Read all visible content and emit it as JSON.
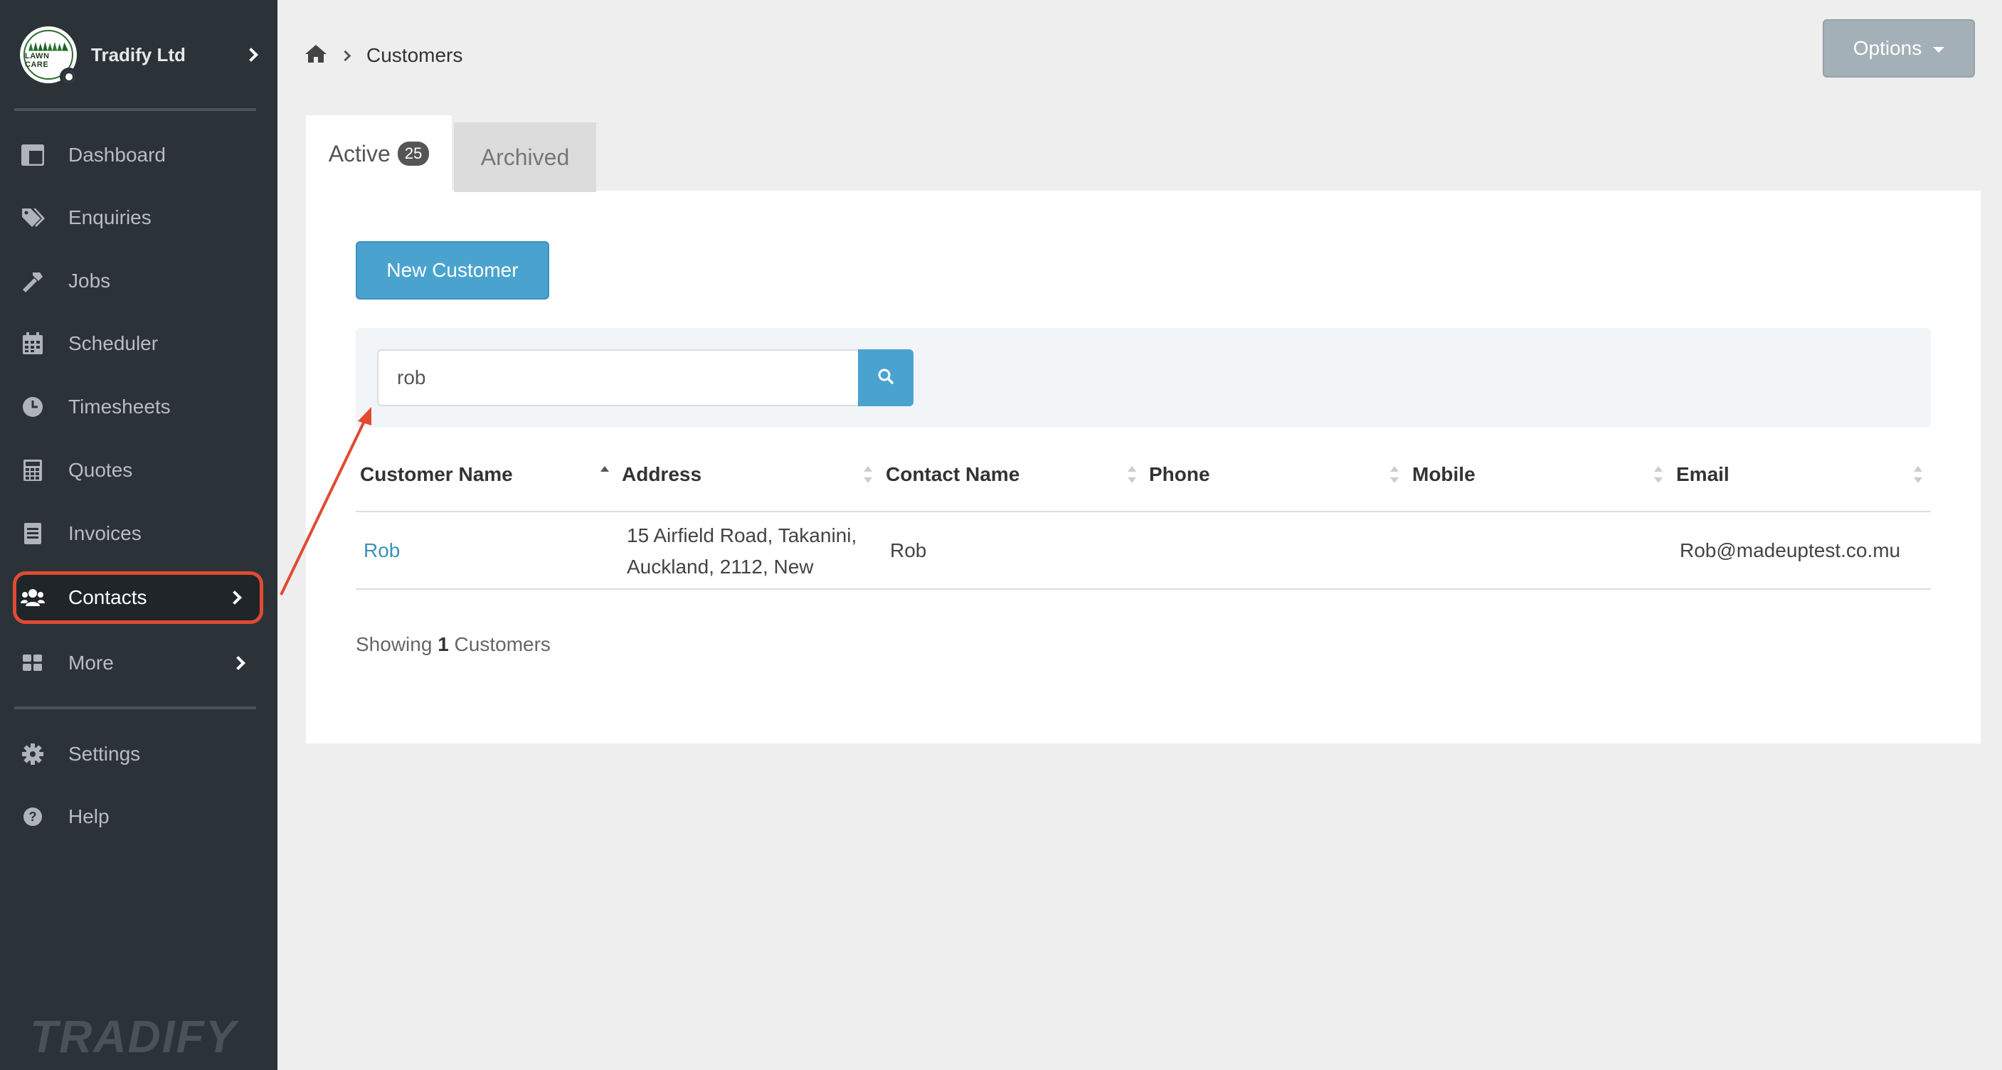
{
  "sidebar": {
    "org_name": "Tradify Ltd",
    "logo_text": "LAWN CARE",
    "items": [
      {
        "label": "Dashboard",
        "icon": "dashboard-icon"
      },
      {
        "label": "Enquiries",
        "icon": "tags-icon"
      },
      {
        "label": "Jobs",
        "icon": "hammer-icon"
      },
      {
        "label": "Scheduler",
        "icon": "calendar-icon"
      },
      {
        "label": "Timesheets",
        "icon": "clock-icon"
      },
      {
        "label": "Quotes",
        "icon": "calculator-icon"
      },
      {
        "label": "Invoices",
        "icon": "invoice-icon"
      },
      {
        "label": "Contacts",
        "icon": "users-icon",
        "active": true
      },
      {
        "label": "More",
        "icon": "grid-icon"
      }
    ],
    "bottom_items": [
      {
        "label": "Settings",
        "icon": "gear-icon"
      },
      {
        "label": "Help",
        "icon": "question-circle-icon"
      }
    ],
    "brand": "TRADIFY"
  },
  "header": {
    "breadcrumb": "Customers",
    "options_label": "Options"
  },
  "tabs": {
    "active_label": "Active",
    "active_count": "25",
    "archived_label": "Archived"
  },
  "actions": {
    "new_customer_label": "New Customer"
  },
  "search": {
    "value": "rob",
    "placeholder": ""
  },
  "table": {
    "columns": [
      "Customer Name",
      "Address",
      "Contact Name",
      "Phone",
      "Mobile",
      "Email"
    ],
    "rows": [
      {
        "customer_name": "Rob",
        "address_line1": "15 Airfield Road, Takanini,",
        "address_line2": "Auckland, 2112, New",
        "contact_name": "Rob",
        "phone": "",
        "mobile": "",
        "email": "Rob@madeuptest.co.mu"
      }
    ]
  },
  "footer": {
    "showing_prefix": "Showing",
    "showing_count": "1",
    "showing_suffix": "Customers"
  },
  "colors": {
    "sidebar_bg": "#2b3338",
    "accent_blue": "#4aa3cf",
    "highlight_red": "#e24a33",
    "options_bg": "#a4b0b8"
  }
}
